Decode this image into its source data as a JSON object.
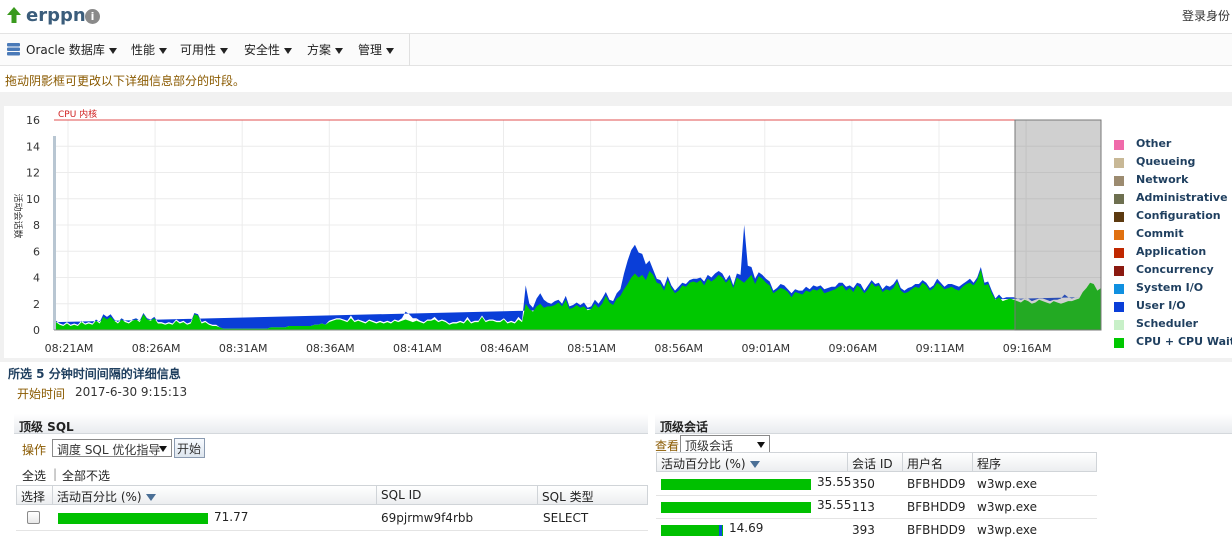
{
  "header": {
    "title": "erppn",
    "info_icon": "info-icon",
    "login_text": "登录身份"
  },
  "menu": {
    "items": [
      {
        "label": "Oracle 数据库",
        "icon": "database-icon"
      },
      {
        "label": "性能"
      },
      {
        "label": "可用性"
      },
      {
        "label": "安全性"
      },
      {
        "label": "方案"
      },
      {
        "label": "管理"
      }
    ]
  },
  "chart_section": {
    "hint": "拖动阴影框可更改以下详细信息部分的时段。"
  },
  "chart_data": {
    "type": "area",
    "ylabel": "活动会话数",
    "ylim": [
      0,
      16
    ],
    "yticks": [
      "0",
      "2",
      "4",
      "6",
      "8",
      "10",
      "12",
      "14",
      "16"
    ],
    "xticks": [
      "08:21AM",
      "08:26AM",
      "08:31AM",
      "08:36AM",
      "08:41AM",
      "08:46AM",
      "08:51AM",
      "08:56AM",
      "09:01AM",
      "09:06AM",
      "09:11AM",
      "09:16AM"
    ],
    "cpu_cores_label": "CPU 内核",
    "cpu_cores_value": 16,
    "selection_window": {
      "start": "09:15AM",
      "end": "09:20AM"
    },
    "series": [
      {
        "name": "CPU + CPU Wait",
        "color": "#00c800",
        "values": [
          0.6,
          0.4,
          0.3,
          0.5,
          0.3,
          0.4,
          0.3,
          0.6,
          0.4,
          0.5,
          0.4,
          0.7,
          0.5,
          1.0,
          0.8,
          1.0,
          0.7,
          0.5,
          0.8,
          0.6,
          0.5,
          0.7,
          0.8,
          0.6,
          1.2,
          0.8,
          0.7,
          0.9,
          0.5,
          0.5,
          0.4,
          0.5,
          0.4,
          0.7,
          0.5,
          0.6,
          0.4,
          0.5,
          1.2,
          1.1,
          0.5,
          0.6,
          0.4,
          0.3,
          0.3,
          0.2,
          0.1,
          0.1,
          0.1,
          0.1,
          0.1,
          0.1,
          0.1,
          0.1,
          0.1,
          0.1,
          0.1,
          0.1,
          0.1,
          0.2,
          0.2,
          0.2,
          0.2,
          0.2,
          0.3,
          0.3,
          0.3,
          0.3,
          0.3,
          0.3,
          0.3,
          0.4,
          0.4,
          0.5,
          0.4,
          0.6,
          0.7,
          0.8,
          0.8,
          0.7,
          0.6,
          0.9,
          0.6,
          0.7,
          0.6,
          0.5,
          0.7,
          0.6,
          0.5,
          0.6,
          0.5,
          0.6,
          0.5,
          0.7,
          0.6,
          0.7,
          0.8,
          0.7,
          0.6,
          0.7,
          0.6,
          0.5,
          0.7,
          0.7,
          0.8,
          0.6,
          0.7,
          0.6,
          0.4,
          0.5,
          0.5,
          0.6,
          0.5,
          0.8,
          0.5,
          0.6,
          0.6,
          1.0,
          0.6,
          0.7,
          0.7,
          0.6,
          0.6,
          0.8,
          0.5,
          0.6,
          0.5,
          0.8,
          0.6,
          2.0,
          1.6,
          1.4,
          1.8,
          2.0,
          1.7,
          1.8,
          1.8,
          1.9,
          2.1,
          1.8,
          2.3,
          1.6,
          1.7,
          1.9,
          1.7,
          1.8,
          1.5,
          1.6,
          2.0,
          1.7,
          2.0,
          2.6,
          2.1,
          1.9,
          2.4,
          2.6,
          3.1,
          3.5,
          4.0,
          4.3,
          4.0,
          4.2,
          3.8,
          4.5,
          4.2,
          3.6,
          3.5,
          3.0,
          3.8,
          3.2,
          2.8,
          3.0,
          3.4,
          3.3,
          3.6,
          3.7,
          3.6,
          3.8,
          3.4,
          3.9,
          3.7,
          3.9,
          4.2,
          4.0,
          3.6,
          3.9,
          3.2,
          4.0,
          3.8,
          3.6,
          3.9,
          4.2,
          3.5,
          4.1,
          3.9,
          3.6,
          3.4,
          2.8,
          3.0,
          3.2,
          3.1,
          2.9,
          2.5,
          2.9,
          2.8,
          2.7,
          3.0,
          2.9,
          3.1,
          3.0,
          3.2,
          2.8,
          2.9,
          3.0,
          3.1,
          3.3,
          3.4,
          3.0,
          3.2,
          2.9,
          3.4,
          3.2,
          2.8,
          3.1,
          3.6,
          3.3,
          3.4,
          2.9,
          3.1,
          3.0,
          3.2,
          3.7,
          3.0,
          2.8,
          2.9,
          3.1,
          3.3,
          3.2,
          3.6,
          3.4,
          3.0,
          3.2,
          3.6,
          3.4,
          3.1,
          3.2,
          3.3,
          3.1,
          3.0,
          3.3,
          3.5,
          3.6,
          3.4,
          3.8,
          4.6,
          3.4,
          3.5,
          2.8,
          2.3,
          2.5,
          2.2,
          2.3,
          2.4,
          2.3,
          2.2,
          2.1,
          2.3,
          2.2,
          2.0,
          2.1,
          2.3,
          2.2,
          2.1,
          2.0,
          2.2,
          2.1,
          2.0,
          2.1,
          2.2,
          2.2,
          2.3,
          2.4,
          2.9,
          3.2,
          3.6,
          3.5,
          3.0,
          3.2
        ]
      },
      {
        "name": "User I/O",
        "color": "#0a3ed8",
        "values": [
          0.1,
          0.1,
          0.1,
          0.1,
          0.1,
          0.1,
          0.1,
          0.1,
          0.1,
          0.1,
          0.1,
          0.1,
          0.1,
          0.2,
          0.2,
          0.2,
          0.1,
          0.1,
          0.1,
          0.1,
          0.1,
          0.1,
          0.1,
          0.1,
          0.1,
          0.1,
          0.1,
          0.1,
          0.1,
          0.1,
          0.1,
          0.1,
          0.1,
          0.1,
          0.1,
          0.1,
          0.1,
          0.1,
          0.1,
          0.1,
          0.1,
          0.1,
          0.1,
          0.1,
          0.1,
          0.0,
          0.0,
          0.0,
          0.0,
          0.0,
          0.0,
          0.0,
          0.0,
          0.0,
          0.0,
          0.0,
          0.0,
          0.0,
          0.0,
          0.0,
          0.0,
          0.0,
          0.0,
          0.0,
          0.0,
          0.0,
          0.0,
          0.0,
          0.0,
          0.0,
          0.0,
          0.0,
          0.0,
          0.0,
          0.0,
          0.1,
          0.1,
          0.1,
          0.1,
          0.1,
          0.1,
          0.2,
          0.1,
          0.1,
          0.1,
          0.1,
          0.1,
          0.1,
          0.1,
          0.1,
          0.1,
          0.1,
          0.1,
          0.1,
          0.1,
          0.2,
          0.6,
          0.5,
          0.3,
          0.2,
          0.1,
          0.1,
          0.1,
          0.1,
          0.2,
          0.1,
          0.1,
          0.1,
          0.1,
          0.1,
          0.1,
          0.1,
          0.1,
          0.2,
          0.1,
          0.1,
          0.1,
          0.1,
          0.1,
          0.1,
          0.1,
          0.1,
          0.1,
          0.1,
          0.1,
          0.1,
          0.1,
          0.2,
          0.1,
          1.4,
          0.4,
          0.3,
          0.6,
          0.8,
          0.6,
          0.3,
          0.2,
          0.3,
          0.2,
          0.2,
          0.3,
          0.2,
          0.2,
          0.2,
          0.2,
          0.3,
          0.2,
          0.2,
          0.3,
          0.3,
          0.4,
          0.3,
          0.2,
          0.3,
          0.4,
          0.5,
          1.2,
          1.8,
          2.1,
          2.2,
          1.9,
          1.6,
          1.2,
          0.8,
          0.4,
          0.3,
          0.3,
          0.3,
          0.3,
          0.2,
          0.2,
          0.3,
          0.2,
          0.2,
          0.2,
          0.2,
          0.3,
          0.2,
          0.3,
          0.3,
          0.3,
          0.4,
          0.3,
          0.3,
          0.2,
          0.3,
          0.2,
          0.3,
          0.4,
          4.4,
          1.0,
          0.6,
          0.4,
          0.3,
          0.3,
          0.3,
          0.3,
          0.2,
          0.2,
          0.3,
          0.3,
          0.2,
          0.3,
          0.2,
          0.2,
          0.3,
          0.3,
          0.2,
          0.3,
          0.3,
          0.2,
          0.3,
          0.3,
          0.3,
          0.2,
          0.3,
          0.2,
          0.3,
          0.2,
          0.3,
          0.2,
          0.3,
          0.2,
          0.3,
          0.2,
          0.2,
          0.2,
          0.2,
          0.3,
          0.3,
          0.3,
          0.2,
          0.2,
          0.2,
          0.3,
          0.2,
          0.2,
          0.3,
          0.2,
          0.2,
          0.2,
          0.2,
          0.3,
          0.2,
          0.2,
          0.3,
          0.2,
          0.3,
          0.3,
          0.2,
          0.2,
          0.3,
          0.2,
          0.2,
          0.2,
          0.2,
          0.2,
          0.2,
          0.1,
          0.2,
          0.2,
          0.2,
          0.1,
          0.2,
          0.2,
          0.2,
          0.1,
          0.2,
          0.2,
          0.2,
          0.1,
          0.2,
          0.2,
          0.2,
          0.1,
          0.2,
          0.4,
          0.6,
          0.3,
          0.2,
          0.2,
          0.1
        ]
      }
    ],
    "legend": [
      "Other",
      "Queueing",
      "Network",
      "Administrative",
      "Configuration",
      "Commit",
      "Application",
      "Concurrency",
      "System I/O",
      "User I/O",
      "Scheduler",
      "CPU + CPU Wait"
    ]
  },
  "legend_colors": {
    "Other": "#f06aaa",
    "Queueing": "#c8b896",
    "Network": "#9c8b70",
    "Administrative": "#6e7050",
    "Configuration": "#5c3a10",
    "Commit": "#e07010",
    "Application": "#c02800",
    "Concurrency": "#8b1a10",
    "System I/O": "#1090e0",
    "User I/O": "#0a3ed8",
    "Scheduler": "#c8f0c8",
    "CPU + CPU Wait": "#00c800"
  },
  "detail": {
    "heading": "所选 5 分钟时间间隔的详细信息",
    "start_label": "开始时间",
    "start_value": "2017-6-30 9:15:13"
  },
  "top_sql": {
    "title": "顶级 SQL",
    "action_label": "操作",
    "action_select": "调度 SQL 优化指导",
    "go_button": "开始",
    "select_all": "全选",
    "select_none": "全部不选",
    "columns": [
      "选择",
      "活动百分比 (%)",
      "SQL ID",
      "SQL 类型"
    ],
    "rows": [
      {
        "activity": "71.77",
        "activity_value": 71.77,
        "sql_id": "69pjrmw9f4rbb",
        "sql_type": "SELECT"
      }
    ]
  },
  "top_sessions": {
    "title": "顶级会话",
    "view_label": "查看",
    "view_select": "顶级会话",
    "columns": [
      "活动百分比 (%)",
      "会话 ID",
      "用户名",
      "程序"
    ],
    "rows": [
      {
        "activity": "35.55",
        "activity_value": 35.55,
        "session_id": "350",
        "user": "BFBHDD9",
        "program": "w3wp.exe"
      },
      {
        "activity": "35.55",
        "activity_value": 35.55,
        "session_id": "113",
        "user": "BFBHDD9",
        "program": "w3wp.exe"
      },
      {
        "activity": "14.69",
        "activity_value": 14.69,
        "session_id": "393",
        "user": "BFBHDD9",
        "program": "w3wp.exe"
      }
    ]
  }
}
